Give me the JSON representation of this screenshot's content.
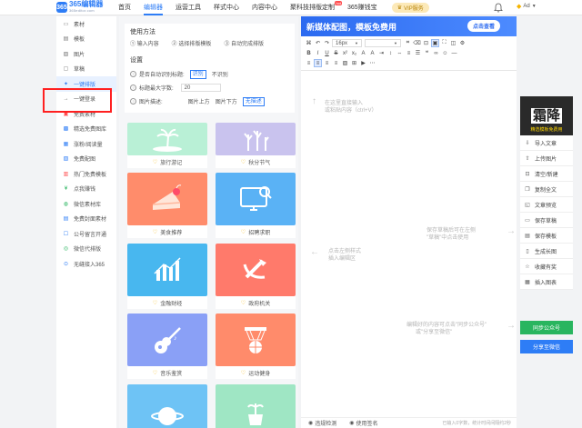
{
  "header": {
    "logo_mark": "365",
    "logo_name": "365编辑器",
    "logo_url": "365editor.com",
    "nav": [
      {
        "label": "首页"
      },
      {
        "label": "编辑器"
      },
      {
        "label": "运营工具"
      },
      {
        "label": "样式中心"
      },
      {
        "label": "内容中心"
      },
      {
        "label": "聚科技排版定制",
        "badge": "hot"
      },
      {
        "label": "365赚钱宝"
      }
    ],
    "vip_label": "VIP服务",
    "account_label": "Ad",
    "accent_color": "#2e7df6"
  },
  "sidebar": {
    "items": [
      {
        "label": "素材",
        "icon": "folder-icon"
      },
      {
        "label": "模板",
        "icon": "template-icon"
      },
      {
        "label": "图片",
        "icon": "image-icon"
      },
      {
        "label": "草稿",
        "icon": "draft-icon"
      },
      {
        "label": "一键排版",
        "icon": "magic-icon",
        "active": true
      },
      {
        "label": "一键登录",
        "icon": "login-icon"
      },
      {
        "label": "免费素材",
        "icon": "free-material-icon"
      },
      {
        "label": "精选免费图库",
        "icon": "gallery-icon"
      },
      {
        "label": "涨粉/阅读量",
        "icon": "growth-icon"
      },
      {
        "label": "免费配图",
        "icon": "picture-icon"
      },
      {
        "label": "热门免费模板",
        "icon": "hot-template-icon"
      },
      {
        "label": "点我赚钱",
        "icon": "money-icon"
      },
      {
        "label": "微信素材库",
        "icon": "wechat-library-icon"
      },
      {
        "label": "免费封面素材",
        "icon": "cover-icon"
      },
      {
        "label": "公号留言开通",
        "icon": "comment-icon"
      },
      {
        "label": "微信代排版",
        "icon": "wechat-icon"
      },
      {
        "label": "无缝接入365",
        "icon": "plug-icon"
      }
    ]
  },
  "template_panel": {
    "usage_title": "使用方法",
    "steps": [
      "① 输入内容",
      "② 选择排版模板",
      "③ 自动完成排版"
    ],
    "settings_title": "设置",
    "auto_title_label": "是否自动识别标题:",
    "auto_title_on": "识别",
    "auto_title_off": "不识别",
    "max_title_label": "标题最大字数:",
    "max_title_value": "20",
    "image_desc_label": "图片描述:",
    "image_desc_options": [
      "图片上方",
      "图片下方",
      "无描述"
    ],
    "cards": [
      {
        "label": "旅行游记",
        "color": "#b9f0d6"
      },
      {
        "label": "秋分节气",
        "color": "#c9c3ee"
      },
      {
        "label": "美食推荐",
        "color": "#ff8c6b"
      },
      {
        "label": "招聘求职",
        "color": "#5ab2f5"
      },
      {
        "label": "金融财经",
        "color": "#48b7ef"
      },
      {
        "label": "政府机关",
        "color": "#ff7a6b"
      },
      {
        "label": "音乐鉴赏",
        "color": "#8aa0f6"
      },
      {
        "label": "运动健身",
        "color": "#ff8b6b"
      },
      {
        "label": "",
        "color": "#6ec3f5"
      },
      {
        "label": "",
        "color": "#9fe6c4"
      }
    ]
  },
  "editor": {
    "banner_text": "新媒体配图，模板免费用",
    "banner_cta": "点击查看",
    "font_size": "16px",
    "hint_top_1": "在这里直接输入",
    "hint_top_2": "或粘贴内容（ctrl+V）",
    "hint_mid_1": "点击左侧样式",
    "hint_mid_2": "插入编辑区",
    "hint_right_1": "保存草稿后可在左侧",
    "hint_right_2": "\"草稿\"中点击使用",
    "hint_bottom_1": "编辑好的内容可点击\"同步公众号\"",
    "hint_bottom_2": "或\"分享至微信\"",
    "status_check": "违规检测",
    "status_sign": "使用签名",
    "status_right": "已输入0字数，统计时间间隔约2秒"
  },
  "right_panel": {
    "promo_big": "霜降",
    "promo_small": "精选模板免费用",
    "actions": [
      {
        "label": "导入文章",
        "icon": "import-icon"
      },
      {
        "label": "上传图片",
        "icon": "upload-icon"
      },
      {
        "label": "清空/新建",
        "icon": "clear-icon"
      },
      {
        "label": "复制全文",
        "icon": "copy-icon"
      },
      {
        "label": "文章预览",
        "icon": "preview-icon"
      },
      {
        "label": "保存草稿",
        "icon": "save-draft-icon"
      },
      {
        "label": "保存模板",
        "icon": "save-template-icon"
      },
      {
        "label": "生成长图",
        "icon": "long-image-icon"
      },
      {
        "label": "收藏有奖",
        "icon": "star-icon"
      },
      {
        "label": "插入图表",
        "icon": "chart-icon"
      }
    ],
    "sync_label": "同步公众号",
    "share_label": "分享至微信"
  }
}
